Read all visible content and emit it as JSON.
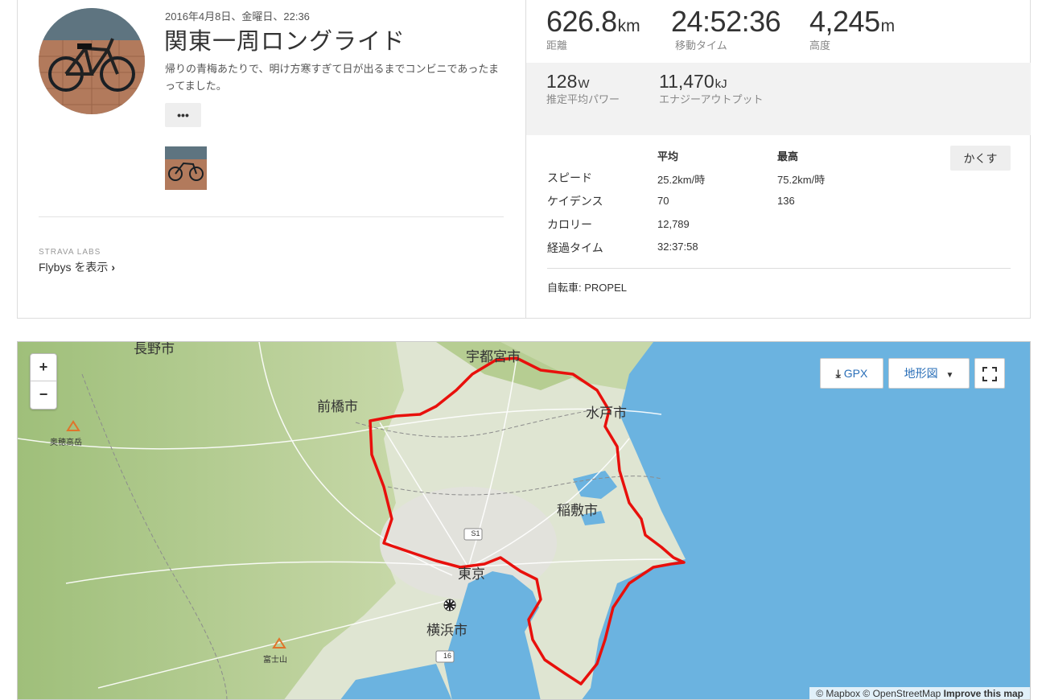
{
  "activity": {
    "date": "2016年4月8日、金曜日、22:36",
    "title": "関東一周ロングライド",
    "description": "帰りの青梅あたりで、明け方寒すぎて日が出るまでコンビニであったまってました。",
    "more_label": "•••",
    "labs_label": "STRAVA LABS",
    "flybys_label": "Flybys を表示",
    "flybys_chevron": "›"
  },
  "stats_main": [
    {
      "value": "626.8",
      "unit": "km",
      "label": "距離"
    },
    {
      "value": "24:52:36",
      "unit": "",
      "label": "移動タイム"
    },
    {
      "value": "4,245",
      "unit": "m",
      "label": "高度"
    }
  ],
  "stats_sub": [
    {
      "value": "128",
      "unit": "W",
      "label": "推定平均パワー"
    },
    {
      "value": "11,470",
      "unit": "kJ",
      "label": "エナジーアウトプット"
    }
  ],
  "details": {
    "col_avg": "平均",
    "col_max": "最高",
    "hide_label": "かくす",
    "rows": [
      {
        "label": "スピード",
        "avg": "25.2km/時",
        "max": "75.2km/時"
      },
      {
        "label": "ケイデンス",
        "avg": "70",
        "max": "136"
      },
      {
        "label": "カロリー",
        "avg": "12,789",
        "max": ""
      },
      {
        "label": "経過タイム",
        "avg": "32:37:58",
        "max": ""
      }
    ],
    "bike": "自転車: PROPEL"
  },
  "map": {
    "zoom_in": "+",
    "zoom_out": "−",
    "gpx_label": "GPX",
    "terrain_label": "地形図",
    "fullscreen_icon": "fullscreen-icon",
    "cities": {
      "nagano": "長野市",
      "utsunomiya": "宇都宮市",
      "maebashi": "前橋市",
      "mito": "水戸市",
      "inashiki": "稲敷市",
      "tokyo": "東京",
      "yokohama": "横浜市",
      "hotaka": "奥穂高岳",
      "fuji": "富士山"
    },
    "road_s1": "S1",
    "road_16": "16",
    "attribution": "© Mapbox © OpenStreetMap",
    "improve": "Improve this map",
    "colors": {
      "route": "#e8100c",
      "sea": "#6bb3e0",
      "land": "#dfe8cf"
    }
  }
}
